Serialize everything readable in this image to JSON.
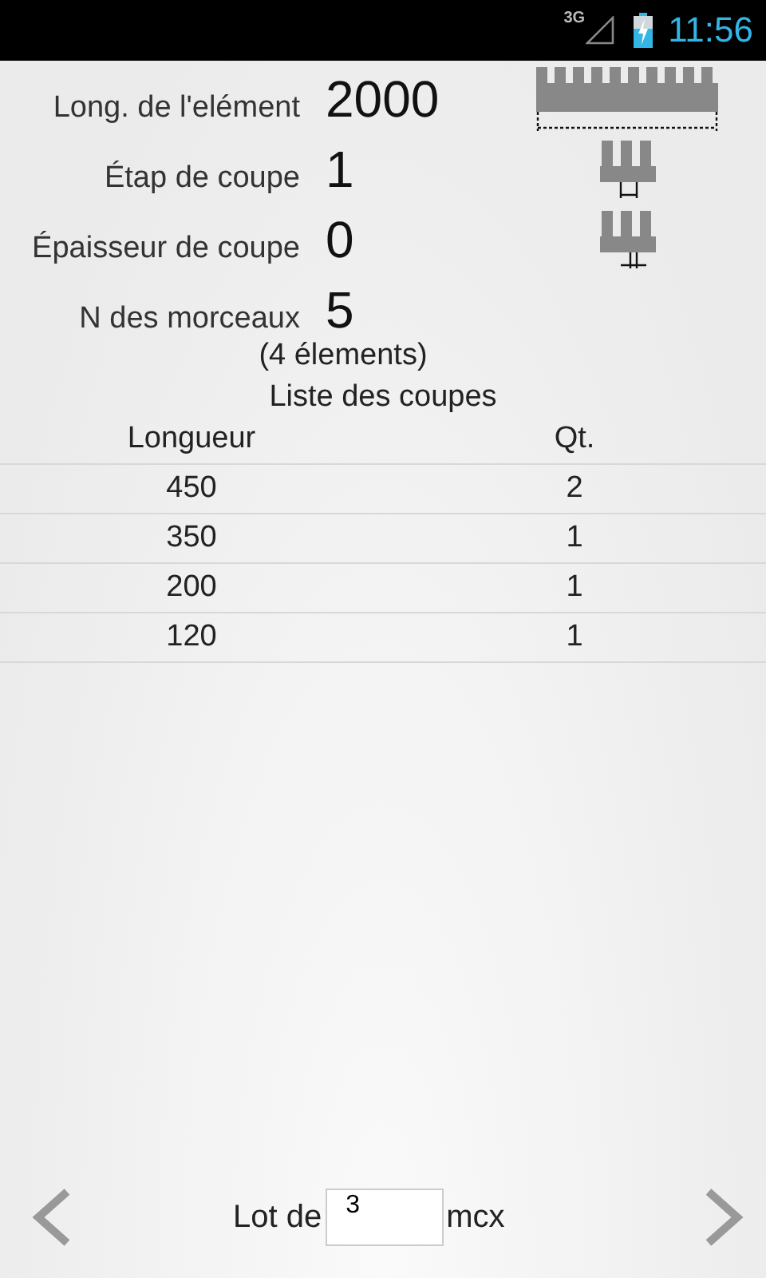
{
  "status_bar": {
    "network": "3G",
    "time": "11:56"
  },
  "fields": [
    {
      "label": "Long. de l'elément",
      "value": "2000"
    },
    {
      "label": "Étap de coupe",
      "value": "1"
    },
    {
      "label": "Épaisseur de coupe",
      "value": "0"
    },
    {
      "label": "N des morceaux",
      "value": "5"
    }
  ],
  "element_count": "(4  élements)",
  "list_title": "Liste des coupes",
  "table": {
    "columns": [
      "Longueur",
      "Qt."
    ],
    "rows": [
      [
        "450",
        "2"
      ],
      [
        "350",
        "1"
      ],
      [
        "200",
        "1"
      ],
      [
        "120",
        "1"
      ]
    ]
  },
  "footer": {
    "prefix": "Lot de",
    "input_value": "3",
    "suffix": "mcx"
  }
}
